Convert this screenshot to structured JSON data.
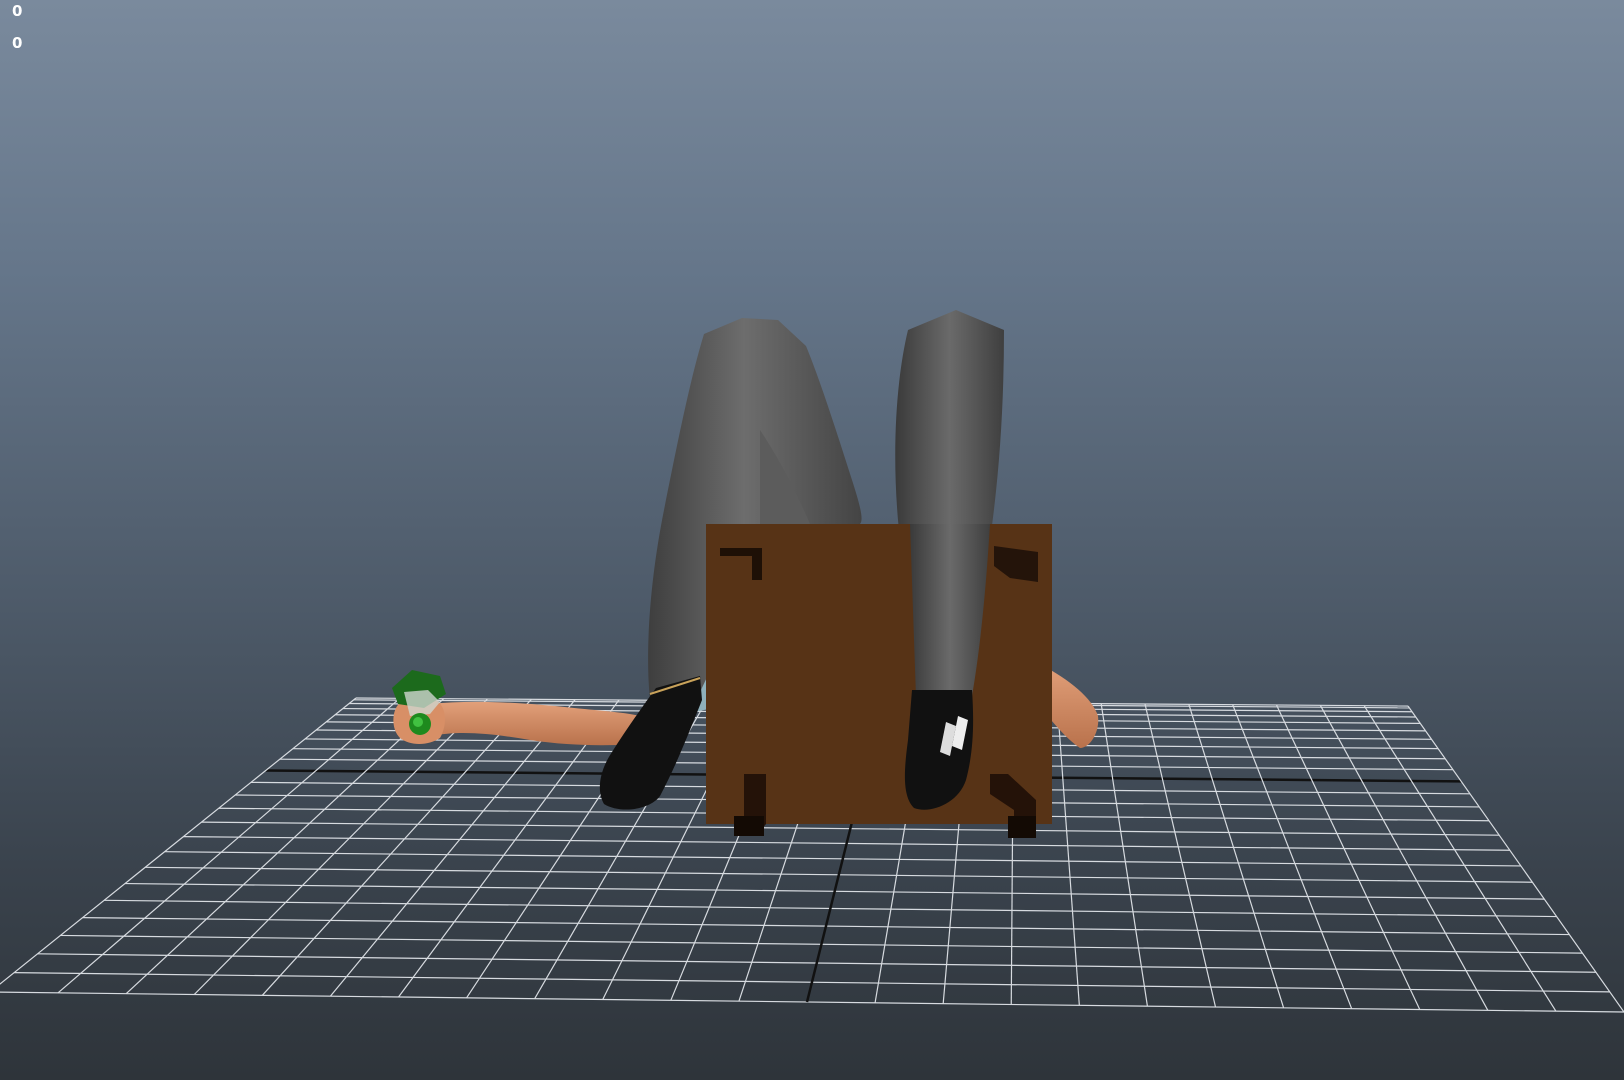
{
  "viewport": {
    "hud_counter_top": "0",
    "hud_counter_bottom": "0"
  },
  "scene": {
    "objects": [
      "ground-grid",
      "wooden-box",
      "character-legs",
      "character-arm",
      "green-bottle"
    ],
    "colors": {
      "background_top": "#7a8a9d",
      "background_bottom": "#2e343a",
      "grid": "#d7dbe0",
      "axis": "#111111",
      "box": "#573316",
      "pants": "#5b5b5b",
      "skin": "#d6936a",
      "bottle": "#1f7a1f"
    }
  }
}
